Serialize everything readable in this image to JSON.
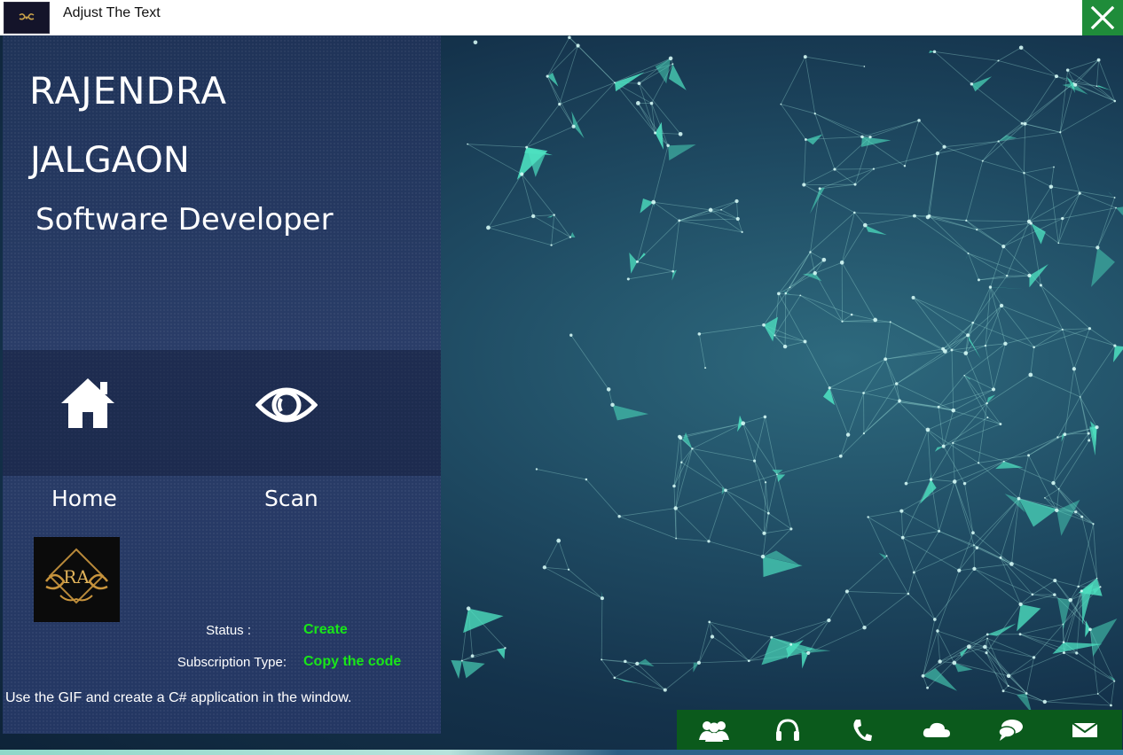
{
  "window": {
    "title": "Adjust The Text",
    "logo_icon": "ra-logo-icon",
    "close_icon": "close-icon",
    "close_color": "#1f8c3a"
  },
  "profile": {
    "line1": "RAJENDRA",
    "line2": "JALGAON",
    "line3": "Software Developer"
  },
  "menu": {
    "items": [
      {
        "label": "Home",
        "icon": "home-icon"
      },
      {
        "label": "Scan",
        "icon": "eye-icon"
      }
    ]
  },
  "info": {
    "logo_text": "RA",
    "status_label": "Status :",
    "status_value": "Create",
    "subscription_label": "Subscription Type:",
    "subscription_value": "Copy the code",
    "value_color": "#19e619"
  },
  "note": "Use the GIF and create a C# application in the window.",
  "toolbar": {
    "color": "#0b5a1c",
    "icons": [
      "users-icon",
      "headphones-icon",
      "phone-icon",
      "cloud-icon",
      "chat-icon",
      "mail-icon"
    ]
  },
  "theme": {
    "accent": "#4de0c0",
    "panel": "#2a3d68"
  }
}
